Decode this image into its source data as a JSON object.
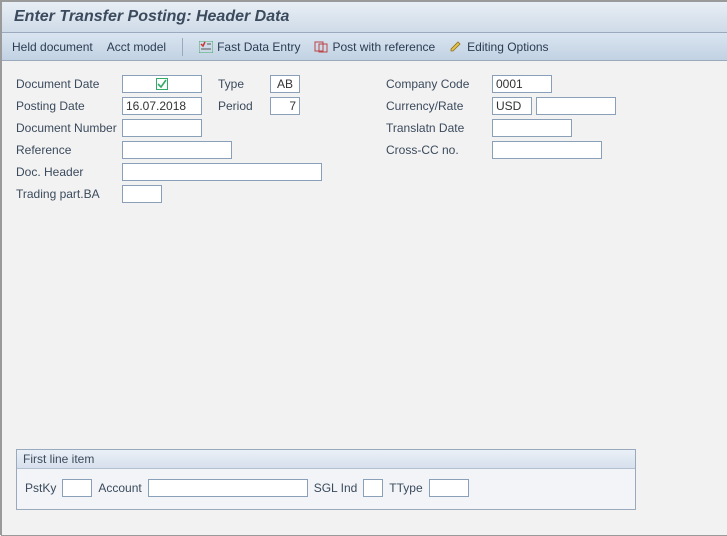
{
  "title": "Enter Transfer Posting: Header Data",
  "toolbar": {
    "held_document": "Held document",
    "acct_model": "Acct model",
    "fast_data_entry": "Fast Data Entry",
    "post_with_reference": "Post with reference",
    "editing_options": "Editing Options"
  },
  "left": {
    "document_date_label": "Document Date",
    "document_date_value": "",
    "type_label": "Type",
    "type_value": "AB",
    "posting_date_label": "Posting Date",
    "posting_date_value": "16.07.2018",
    "period_label": "Period",
    "period_value": "7",
    "document_number_label": "Document Number",
    "document_number_value": "",
    "reference_label": "Reference",
    "reference_value": "",
    "doc_header_label": "Doc. Header",
    "doc_header_value": "",
    "trading_part_ba_label": "Trading part.BA",
    "trading_part_ba_value": ""
  },
  "right": {
    "company_code_label": "Company Code",
    "company_code_value": "0001",
    "currency_rate_label": "Currency/Rate",
    "currency_rate_value": "USD",
    "currency_rate_value2": "",
    "translatn_date_label": "Translatn Date",
    "translatn_date_value": "",
    "cross_cc_no_label": "Cross-CC no.",
    "cross_cc_no_value": ""
  },
  "first_line_item": {
    "legend": "First line item",
    "pstky_label": "PstKy",
    "pstky_value": "",
    "account_label": "Account",
    "account_value": "",
    "sgl_ind_label": "SGL Ind",
    "sgl_ind_value": "",
    "ttype_label": "TType",
    "ttype_value": ""
  }
}
